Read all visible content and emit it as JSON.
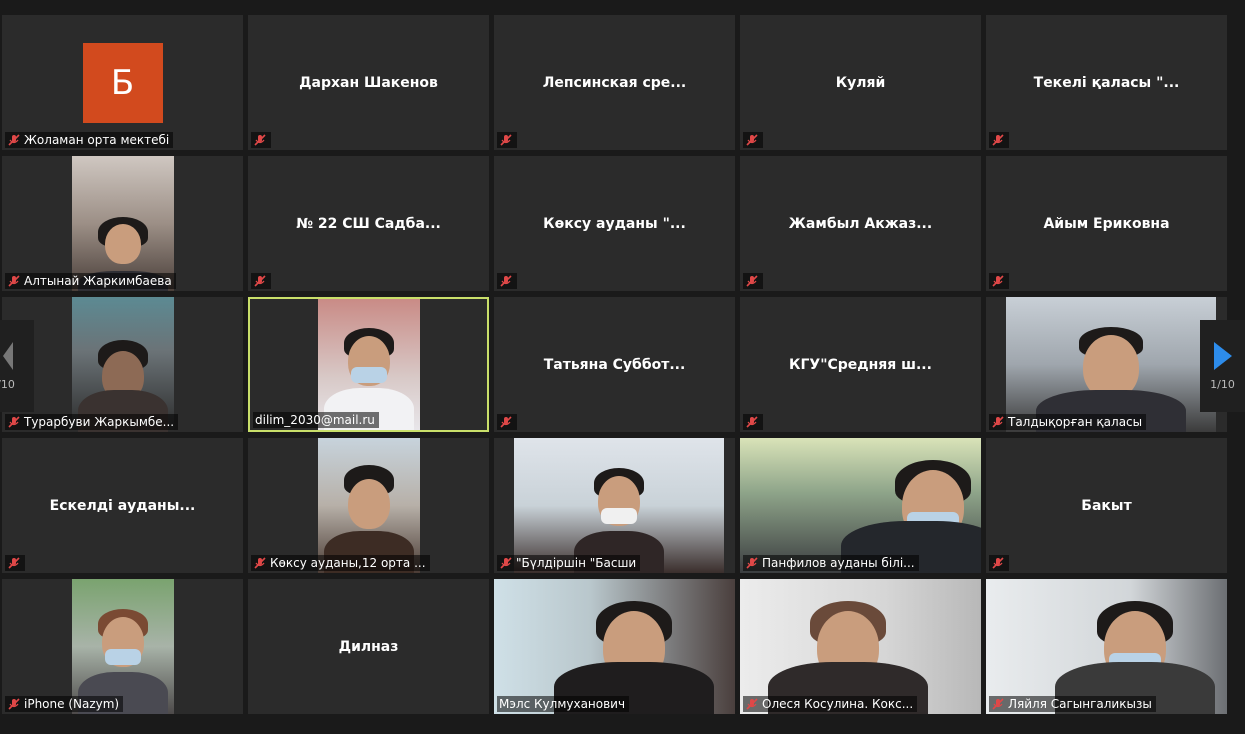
{
  "colors": {
    "tile_bg": "#2b2b2b",
    "active_border": "#c9df6a",
    "muted": "#e04848",
    "nav_arrow": "#2d8ceb",
    "avatar_b": "#d24a1e"
  },
  "avatar_letter": "Б",
  "tiles": [
    {
      "center_name": "",
      "label": "Жоламан орта мектебі"
    },
    {
      "center_name": "Дархан Шакенов",
      "label": ""
    },
    {
      "center_name": "Лепсинская  сре...",
      "label": ""
    },
    {
      "center_name": "Куляй",
      "label": ""
    },
    {
      "center_name": "Текелі қаласы  \"...",
      "label": ""
    },
    {
      "center_name": "",
      "label": "Алтынай Жаркимбаева"
    },
    {
      "center_name": "№ 22 СШ Садба...",
      "label": ""
    },
    {
      "center_name": "Көксу ауданы  \"...",
      "label": ""
    },
    {
      "center_name": "Жамбыл  Акжаз...",
      "label": ""
    },
    {
      "center_name": "Айым Ериковна",
      "label": ""
    },
    {
      "center_name": "",
      "label": "Турарбуви Жаркымбе..."
    },
    {
      "center_name": "",
      "label": "dilim_2030@mail.ru"
    },
    {
      "center_name": "Татьяна  Суббот...",
      "label": ""
    },
    {
      "center_name": "КГУ\"Средняя  ш...",
      "label": ""
    },
    {
      "center_name": "",
      "label": "Талдықорған қаласы"
    },
    {
      "center_name": "Ескелді ауданы...",
      "label": ""
    },
    {
      "center_name": "",
      "label": "Көксу ауданы,12 орта ..."
    },
    {
      "center_name": "",
      "label": "\"Бүлдіршін \"Басши"
    },
    {
      "center_name": "",
      "label": "Панфилов ауданы білі..."
    },
    {
      "center_name": "Бакыт",
      "label": ""
    },
    {
      "center_name": "",
      "label": "iPhone (Nazym)"
    },
    {
      "center_name": "Дилназ",
      "label": ""
    },
    {
      "center_name": "",
      "label": "Мэлс Кулмуханович"
    },
    {
      "center_name": "",
      "label": "Олеся Косулина. Кокс..."
    },
    {
      "center_name": "",
      "label": "Ляйля Сагынгаликызы"
    }
  ],
  "nav": {
    "left_page": "/10",
    "right_page": "1/10"
  }
}
